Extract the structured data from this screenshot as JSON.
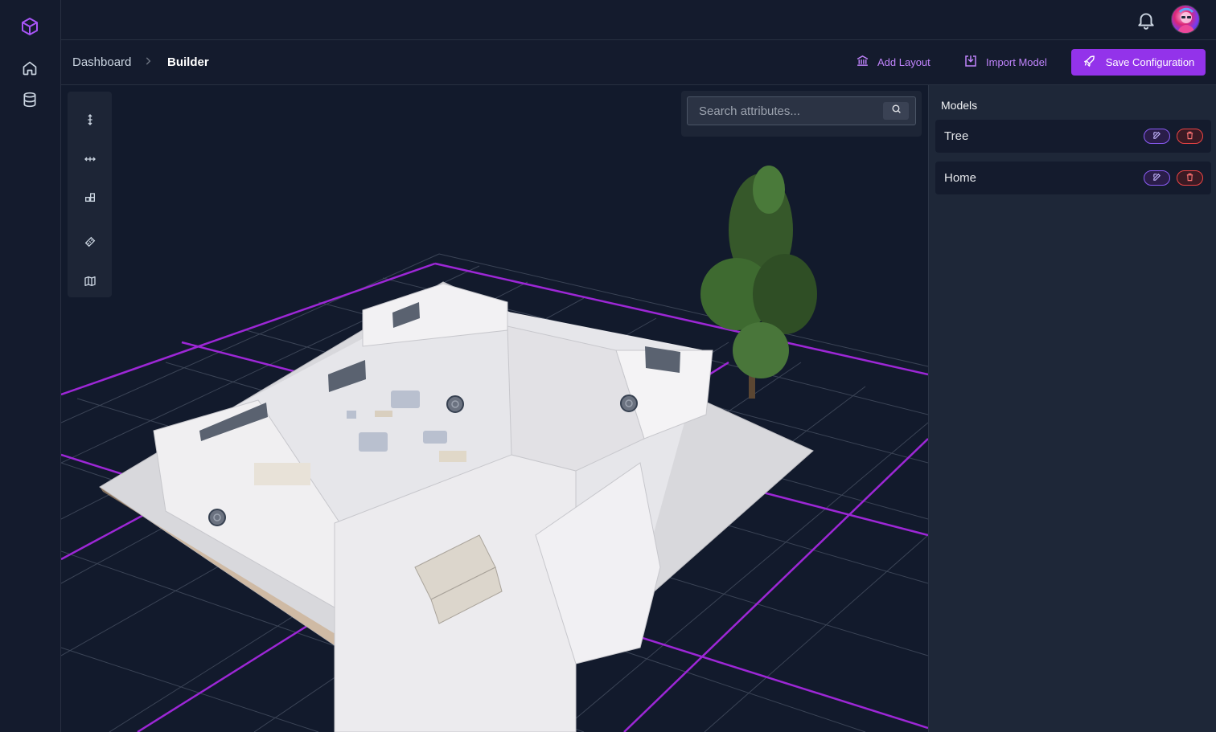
{
  "colors": {
    "accent": "#9333ea",
    "accent_text": "#c084fc",
    "background": "#121a2c",
    "danger": "#ef4444",
    "grid_line": "#4b5563",
    "grid_major": "#a21caf"
  },
  "rail": {
    "logo_icon": "cube-icon",
    "items": [
      {
        "icon": "home-icon"
      },
      {
        "icon": "database-icon"
      }
    ]
  },
  "topbar": {
    "notification_icon": "bell-icon",
    "avatar_icon": "user-avatar"
  },
  "breadcrumb": {
    "items": [
      "Dashboard",
      "Builder"
    ],
    "separator_icon": "chevron-right-icon"
  },
  "actions": {
    "add_layout": {
      "label": "Add Layout",
      "icon": "bank-icon"
    },
    "import_model": {
      "label": "Import Model",
      "icon": "import-icon"
    },
    "save_configuration": {
      "label": "Save Configuration",
      "icon": "rocket-icon"
    }
  },
  "tools": [
    {
      "icon": "move-vertical-icon"
    },
    {
      "icon": "move-horizontal-icon"
    },
    {
      "icon": "shapes-icon"
    },
    {
      "icon": "ruler-icon"
    },
    {
      "icon": "map-icon"
    }
  ],
  "search": {
    "placeholder": "Search attributes...",
    "value": "",
    "icon": "search-icon"
  },
  "models_panel": {
    "title": "Models",
    "items": [
      {
        "name": "Tree",
        "edit_icon": "edit-icon",
        "delete_icon": "trash-icon"
      },
      {
        "name": "Home",
        "edit_icon": "edit-icon",
        "delete_icon": "trash-icon"
      }
    ]
  },
  "scene": {
    "objects": [
      "house-floorplan-3d",
      "tree-3d"
    ],
    "hotspot_icon": "target-icon"
  }
}
